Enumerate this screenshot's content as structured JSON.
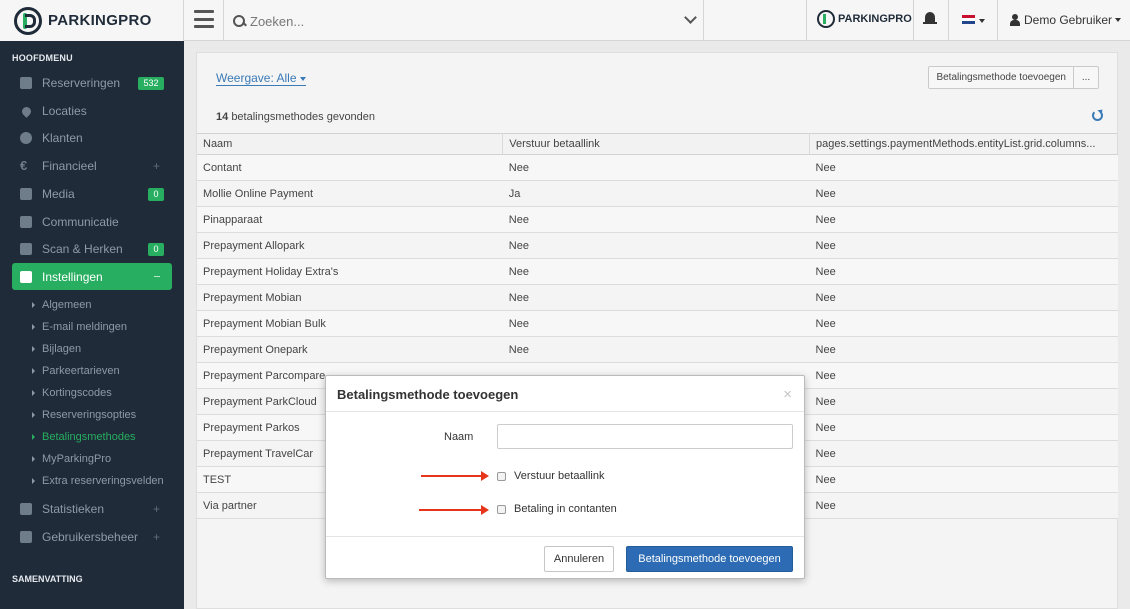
{
  "header": {
    "logo_text": "PARKINGPRO",
    "search_placeholder": "Zoeken...",
    "user_name": "Demo Gebruiker",
    "flag_colors": [
      "#c8102e",
      "#ffffff",
      "#21468b"
    ]
  },
  "sidebar": {
    "section_title": "HOOFDMENU",
    "items": [
      {
        "label": "Reserveringen",
        "badge": "532",
        "icon": "calendar-icon"
      },
      {
        "label": "Locaties",
        "icon": "map-marker-icon"
      },
      {
        "label": "Klanten",
        "icon": "user-icon"
      },
      {
        "label": "Financieel",
        "icon": "euro-icon",
        "expand": "+"
      },
      {
        "label": "Media",
        "badge": "0",
        "icon": "image-icon"
      },
      {
        "label": "Communicatie",
        "icon": "envelope-icon"
      },
      {
        "label": "Scan & Herken",
        "badge": "0",
        "icon": "camera-icon"
      },
      {
        "label": "Instellingen",
        "icon": "wrench-icon"
      }
    ],
    "sub_items": [
      "Algemeen",
      "E-mail meldingen",
      "Bijlagen",
      "Parkeertarieven",
      "Kortingscodes",
      "Reserveringsopties",
      "Betalingsmethodes",
      "MyParkingPro",
      "Extra reserveringsvelden"
    ],
    "bottom_items": [
      {
        "label": "Statistieken",
        "icon": "bar-chart-icon",
        "expand": "+"
      },
      {
        "label": "Gebruikersbeheer",
        "icon": "lock-icon",
        "expand": "+"
      }
    ],
    "footer_title": "SAMENVATTING"
  },
  "main": {
    "view_label": "Weergave: Alle",
    "add_button": "Betalingsmethode toevoegen",
    "more_button": "...",
    "count": "14",
    "count_text": "betalingsmethodes gevonden",
    "columns": [
      "Naam",
      "Verstuur betaallink",
      "pages.settings.paymentMethods.entityList.grid.columns..."
    ],
    "rows": [
      [
        "Contant",
        "Nee",
        "Nee"
      ],
      [
        "Mollie Online Payment",
        "Ja",
        "Nee"
      ],
      [
        "Pinapparaat",
        "Nee",
        "Nee"
      ],
      [
        "Prepayment Allopark",
        "Nee",
        "Nee"
      ],
      [
        "Prepayment Holiday Extra's",
        "Nee",
        "Nee"
      ],
      [
        "Prepayment Mobian",
        "Nee",
        "Nee"
      ],
      [
        "Prepayment Mobian Bulk",
        "Nee",
        "Nee"
      ],
      [
        "Prepayment Onepark",
        "Nee",
        "Nee"
      ],
      [
        "Prepayment Parcompare",
        "",
        "Nee"
      ],
      [
        "Prepayment ParkCloud",
        "",
        "Nee"
      ],
      [
        "Prepayment Parkos",
        "",
        "Nee"
      ],
      [
        "Prepayment TravelCar",
        "",
        "Nee"
      ],
      [
        "TEST",
        "",
        "Nee"
      ],
      [
        "Via partner",
        "",
        "Nee"
      ]
    ]
  },
  "modal": {
    "title": "Betalingsmethode toevoegen",
    "close": "×",
    "name_label": "Naam",
    "name_value": "",
    "checkbox_1": "Verstuur betaallink",
    "checkbox_2": "Betaling in contanten",
    "cancel_label": "Annuleren",
    "submit_label": "Betalingsmethode toevoegen"
  }
}
